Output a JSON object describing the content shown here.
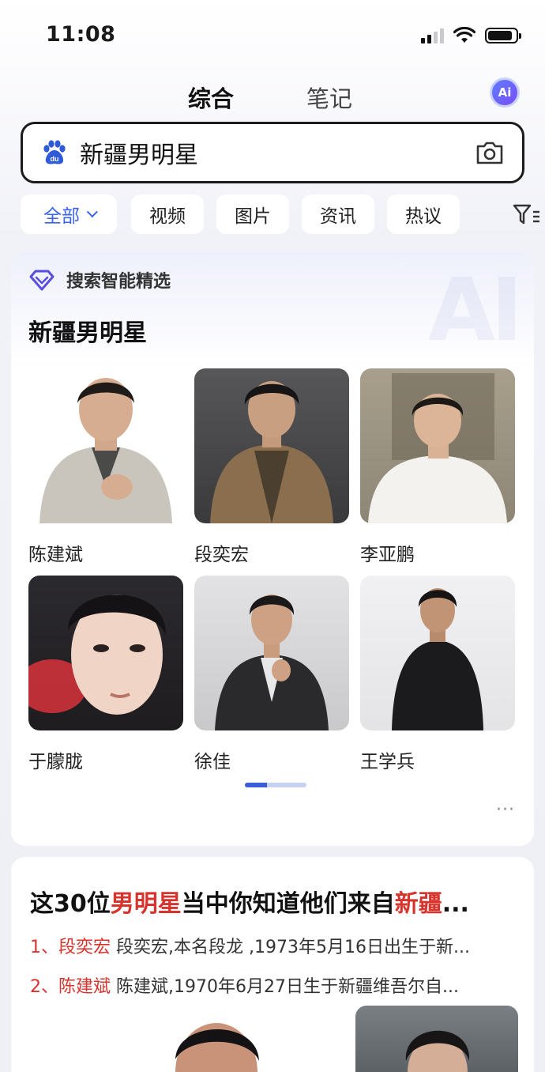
{
  "status_bar": {
    "time": "11:08"
  },
  "top_tabs": {
    "main": "综合",
    "notes": "笔记",
    "ai_label": "Ai"
  },
  "search": {
    "query": "新疆男明星"
  },
  "filters": {
    "items": [
      "全部",
      "视频",
      "图片",
      "资讯",
      "热议"
    ],
    "active": "全部"
  },
  "smart_card": {
    "badge": "搜索智能精选",
    "watermark": "AI",
    "heading": "新疆男明星",
    "people": [
      {
        "name": "陈建斌"
      },
      {
        "name": "段奕宏"
      },
      {
        "name": "李亚鹏"
      },
      {
        "name": "于朦胧"
      },
      {
        "name": "徐佳"
      },
      {
        "name": "王学兵"
      }
    ],
    "more": "···"
  },
  "article": {
    "title_parts": [
      "这30位",
      "男明星",
      "当中你知道他们来自",
      "新疆",
      "..."
    ],
    "lines": [
      {
        "lead": "1、段奕宏",
        "text": " 段奕宏,本名段龙 ,1973年5月16日出生于新..."
      },
      {
        "lead": "2、陈建斌",
        "text": " 陈建斌,1970年6月27日生于新疆维吾尔自..."
      }
    ]
  },
  "colors": {
    "accent": "#3a62e6",
    "highlight": "#d8342e"
  }
}
